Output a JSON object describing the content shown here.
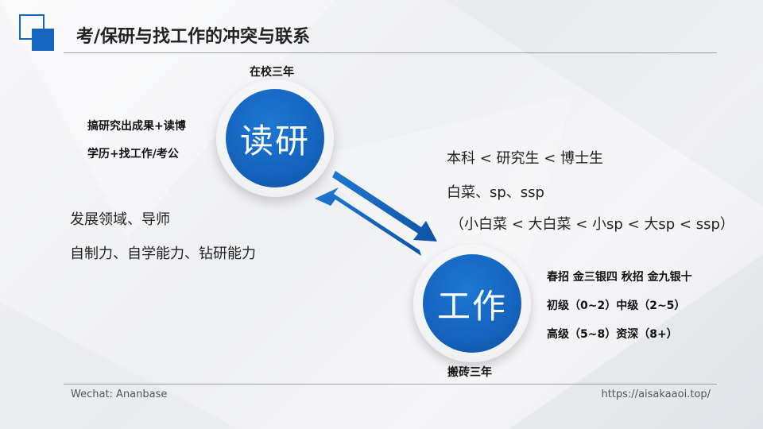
{
  "header": {
    "title": "考/保研与找工作的冲突与联系"
  },
  "circles": {
    "study": {
      "label": "读研",
      "caption": "在校三年"
    },
    "work": {
      "label": "工作",
      "caption": "搬砖三年"
    }
  },
  "left_notes": {
    "line1": "搞研究出成果+读博",
    "line2": "学历+找工作/考公",
    "line3": "发展领域、导师",
    "line4": "自制力、自学能力、钻研能力"
  },
  "right_notes": {
    "line1": "本科 < 研究生 < 博士生",
    "line2": "白菜、sp、ssp",
    "line3": "（小白菜 < 大白菜 < 小sp < 大sp < ssp）"
  },
  "work_notes": {
    "line1": "春招 金三银四 秋招 金九银十",
    "line2": "初级（0~2）中级（2~5）",
    "line3": "高级（5~8）资深（8+）"
  },
  "footer": {
    "left": "Wechat: Ananbase",
    "right": "https://aisakaaoi.top/"
  },
  "colors": {
    "accent": "#1565c0"
  }
}
